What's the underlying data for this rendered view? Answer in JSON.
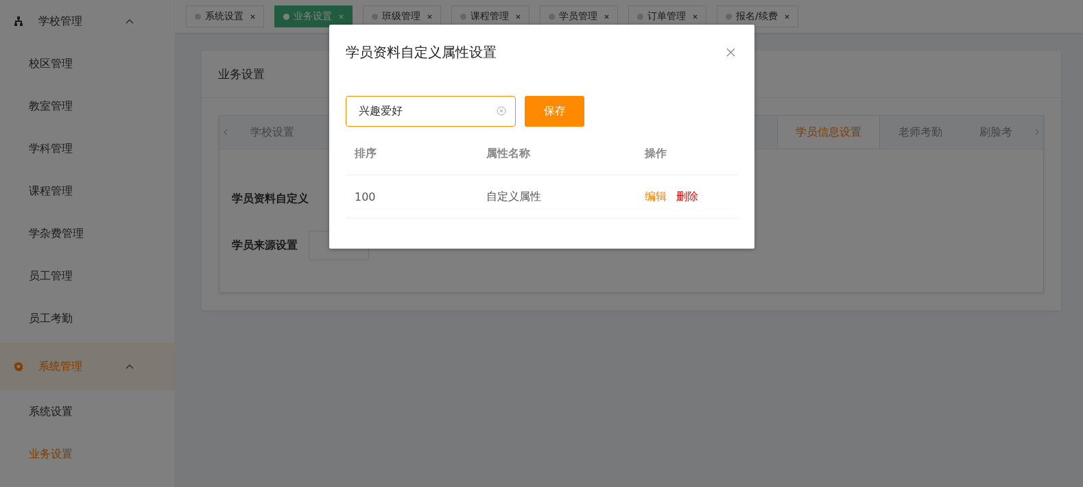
{
  "sidebar": {
    "groups": [
      {
        "label": "学校管理",
        "expanded": true,
        "selected": false,
        "children": [
          {
            "label": "校区管理",
            "selected": false
          },
          {
            "label": "教室管理",
            "selected": false
          },
          {
            "label": "学科管理",
            "selected": false
          },
          {
            "label": "课程管理",
            "selected": false
          },
          {
            "label": "学杂费管理",
            "selected": false
          },
          {
            "label": "员工管理",
            "selected": false
          },
          {
            "label": "员工考勤",
            "selected": false
          }
        ]
      },
      {
        "label": "系统管理",
        "expanded": true,
        "selected": true,
        "children": [
          {
            "label": "系统设置",
            "selected": false
          },
          {
            "label": "业务设置",
            "selected": true
          }
        ]
      }
    ]
  },
  "tags": [
    {
      "label": "系统设置",
      "selected": false
    },
    {
      "label": "业务设置",
      "selected": true
    },
    {
      "label": "班级管理",
      "selected": false
    },
    {
      "label": "课程管理",
      "selected": false
    },
    {
      "label": "学员管理",
      "selected": false
    },
    {
      "label": "订单管理",
      "selected": false
    },
    {
      "label": "报名/续费",
      "selected": false
    }
  ],
  "card": {
    "title": "业务设置",
    "left_tabs": [
      {
        "label": "学校设置",
        "selected": false
      }
    ],
    "right_tabs": [
      {
        "label": "学员信息设置",
        "selected": true
      },
      {
        "label": "老师考勤",
        "selected": false
      },
      {
        "label": "刷脸考",
        "selected": false
      }
    ],
    "rows": [
      {
        "label": "学员资料自定义",
        "button": false
      },
      {
        "label": "学员来源设置",
        "button": true
      }
    ]
  },
  "dialog": {
    "title": "学员资料自定义属性设置",
    "input": {
      "value": "兴趣爱好"
    },
    "save": "保存",
    "columns": [
      "排序",
      "属性名称",
      "操作"
    ],
    "rows": [
      {
        "order": "100",
        "name": "自定义属性",
        "edit": "编辑",
        "delete": "删除"
      }
    ]
  }
}
